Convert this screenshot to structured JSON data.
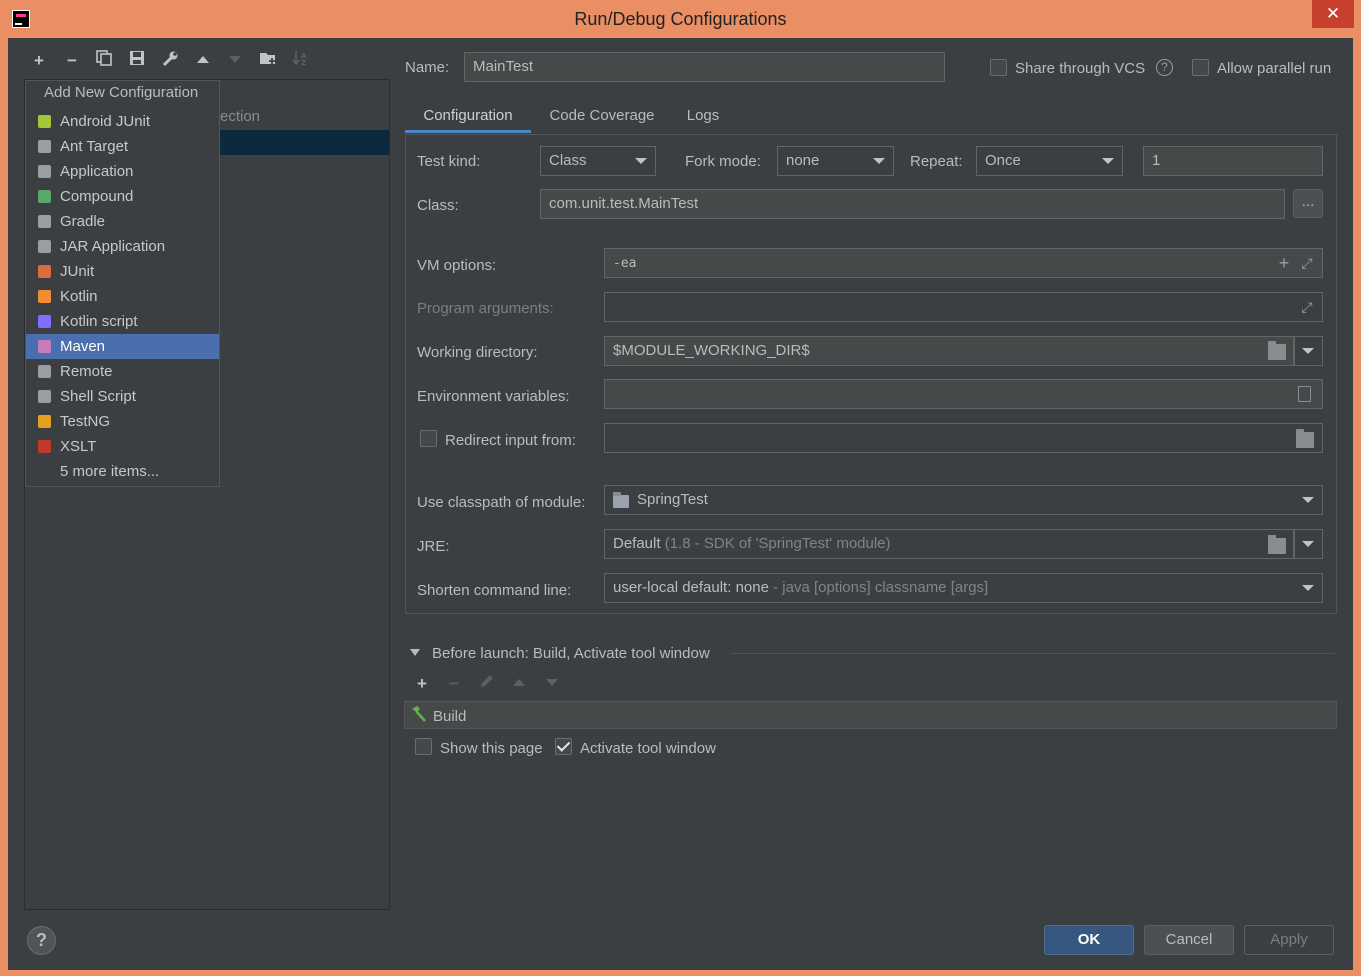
{
  "window": {
    "title": "Run/Debug Configurations",
    "close_label": "✕"
  },
  "left_toolbar": {
    "add": "+",
    "remove": "−",
    "copy": "⧉",
    "save": "▪",
    "wrench": "🔧",
    "up": "▲",
    "down": "▼",
    "folder": "📁",
    "sort": "↓ᶻ"
  },
  "tree": {
    "ghost_text": "ection"
  },
  "popup": {
    "title": "Add New Configuration",
    "items": [
      {
        "label": "Android JUnit",
        "icon": "android-junit-icon",
        "color": "#a4c639"
      },
      {
        "label": "Ant Target",
        "icon": "ant-icon",
        "color": "#9a9ea2"
      },
      {
        "label": "Application",
        "icon": "application-icon",
        "color": "#9a9ea2"
      },
      {
        "label": "Compound",
        "icon": "compound-icon",
        "color": "#59a869"
      },
      {
        "label": "Gradle",
        "icon": "gradle-icon",
        "color": "#9a9ea2"
      },
      {
        "label": "JAR Application",
        "icon": "jar-icon",
        "color": "#9a9ea2"
      },
      {
        "label": "JUnit",
        "icon": "junit-icon",
        "color": "#e06b3a"
      },
      {
        "label": "Kotlin",
        "icon": "kotlin-icon",
        "color": "#f18e33"
      },
      {
        "label": "Kotlin script",
        "icon": "kotlin-script-icon",
        "color": "#7f6eff"
      },
      {
        "label": "Maven",
        "icon": "maven-icon",
        "color": "#c77dbb"
      },
      {
        "label": "Remote",
        "icon": "remote-icon",
        "color": "#9a9ea2"
      },
      {
        "label": "Shell Script",
        "icon": "shell-icon",
        "color": "#9a9ea2"
      },
      {
        "label": "TestNG",
        "icon": "testng-icon",
        "color": "#e5a023"
      },
      {
        "label": "XSLT",
        "icon": "xslt-icon",
        "color": "#c0392b"
      },
      {
        "label": "5 more items...",
        "icon": "",
        "color": ""
      }
    ],
    "selected_index": 9
  },
  "header": {
    "name_label": "Name:",
    "name_value": "MainTest",
    "share_vcs_label": "Share through VCS",
    "allow_parallel_label": "Allow parallel run"
  },
  "tabs": [
    {
      "label": "Configuration"
    },
    {
      "label": "Code Coverage"
    },
    {
      "label": "Logs"
    }
  ],
  "config": {
    "test_kind_label": "Test kind:",
    "test_kind_value": "Class",
    "fork_mode_label": "Fork mode:",
    "fork_mode_value": "none",
    "repeat_label": "Repeat:",
    "repeat_value": "Once",
    "repeat_count": "1",
    "class_label": "Class:",
    "class_value": "com.unit.test.MainTest",
    "browse_label": "...",
    "vm_options_label": "VM options:",
    "vm_options_value": "-ea",
    "program_args_label": "Program arguments:",
    "program_args_value": "",
    "working_dir_label": "Working directory:",
    "working_dir_value": "$MODULE_WORKING_DIR$",
    "env_vars_label": "Environment variables:",
    "env_vars_value": "",
    "redirect_label": "Redirect input from:",
    "redirect_value": "",
    "classpath_label": "Use classpath of module:",
    "classpath_value": "SpringTest",
    "jre_label": "JRE:",
    "jre_value": "Default",
    "jre_hint": "(1.8 - SDK of 'SpringTest' module)",
    "shorten_label": "Shorten command line:",
    "shorten_value": "user-local default: none",
    "shorten_hint": "- java [options] classname [args]"
  },
  "before_launch": {
    "title": "Before launch: Build, Activate tool window",
    "build_label": "Build",
    "show_page_label": "Show this page",
    "activate_label": "Activate tool window"
  },
  "buttons": {
    "ok": "OK",
    "cancel": "Cancel",
    "apply": "Apply",
    "help": "?"
  }
}
